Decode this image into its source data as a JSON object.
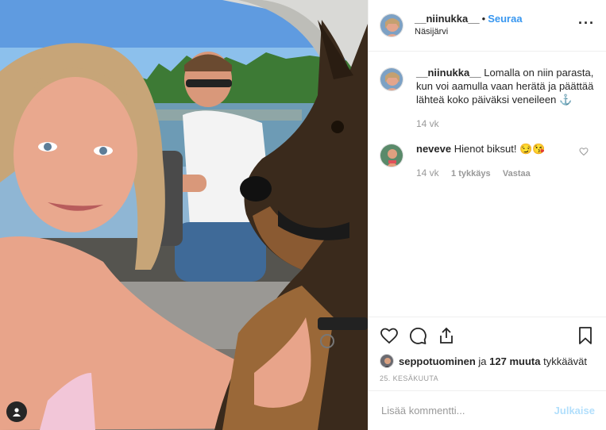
{
  "header": {
    "username": "__niinukka__",
    "separator": "•",
    "follow_label": "Seuraa",
    "location": "Näsijärvi",
    "more_icon": "more-options-icon"
  },
  "caption": {
    "username": "__niinukka__",
    "text": "Lomalla on niin parasta, kun voi aamulla vaan herätä ja päättää lähteä koko päiväksi veneileen ⚓",
    "age": "14 vk"
  },
  "comments": [
    {
      "username": "neveve",
      "text": "Hienot biksut! 😏😘",
      "age": "14 vk",
      "likes": "1 tykkäys",
      "reply": "Vastaa"
    }
  ],
  "actions": {
    "icons": [
      "heart-icon",
      "comment-icon",
      "share-icon",
      "bookmark-icon"
    ]
  },
  "likes": {
    "first_user": "seppotuominen",
    "joiner": "ja",
    "others": "127 muuta",
    "suffix": "tykkäävät"
  },
  "date": "25. KESÄKUUTA",
  "add_comment": {
    "placeholder": "Lisää kommentti...",
    "post_label": "Julkaise"
  },
  "colors": {
    "follow": "#3897f0",
    "post_disabled": "#b2dffc",
    "muted": "#999999",
    "text": "#262626"
  }
}
